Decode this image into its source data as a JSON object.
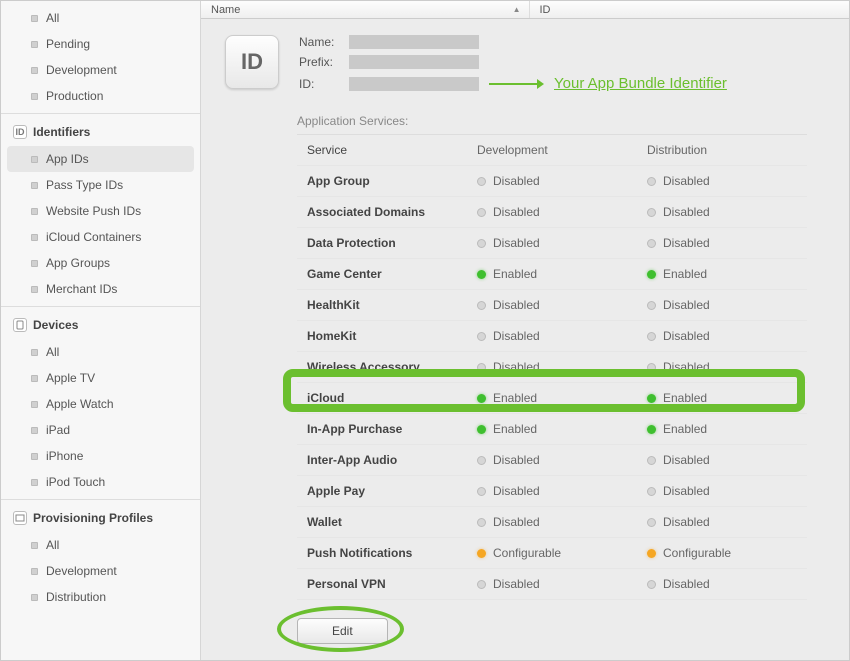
{
  "sidebar": {
    "top_items": [
      {
        "label": "All"
      },
      {
        "label": "Pending"
      },
      {
        "label": "Development"
      },
      {
        "label": "Production"
      }
    ],
    "identifiers": {
      "title": "Identifiers",
      "icon_text": "ID",
      "items": [
        {
          "label": "App IDs",
          "selected": true
        },
        {
          "label": "Pass Type IDs"
        },
        {
          "label": "Website Push IDs"
        },
        {
          "label": "iCloud Containers"
        },
        {
          "label": "App Groups"
        },
        {
          "label": "Merchant IDs"
        }
      ]
    },
    "devices": {
      "title": "Devices",
      "items": [
        {
          "label": "All"
        },
        {
          "label": "Apple TV"
        },
        {
          "label": "Apple Watch"
        },
        {
          "label": "iPad"
        },
        {
          "label": "iPhone"
        },
        {
          "label": "iPod Touch"
        }
      ]
    },
    "provisioning": {
      "title": "Provisioning Profiles",
      "items": [
        {
          "label": "All"
        },
        {
          "label": "Development"
        },
        {
          "label": "Distribution"
        }
      ]
    }
  },
  "table_header": {
    "name": "Name",
    "id": "ID"
  },
  "detail": {
    "icon_text": "ID",
    "name_label": "Name:",
    "prefix_label": "Prefix:",
    "id_label": "ID:",
    "annotation": "Your App Bundle Identifier",
    "services_header": "Application Services:",
    "columns": {
      "service": "Service",
      "development": "Development",
      "distribution": "Distribution"
    },
    "status": {
      "enabled": "Enabled",
      "disabled": "Disabled",
      "configurable": "Configurable"
    },
    "services": [
      {
        "name": "App Group",
        "dev": "disabled",
        "dist": "disabled"
      },
      {
        "name": "Associated Domains",
        "dev": "disabled",
        "dist": "disabled"
      },
      {
        "name": "Data Protection",
        "dev": "disabled",
        "dist": "disabled"
      },
      {
        "name": "Game Center",
        "dev": "enabled",
        "dist": "enabled"
      },
      {
        "name": "HealthKit",
        "dev": "disabled",
        "dist": "disabled"
      },
      {
        "name": "HomeKit",
        "dev": "disabled",
        "dist": "disabled"
      },
      {
        "name": "Wireless Accessory",
        "dev": "disabled",
        "dist": "disabled"
      },
      {
        "name": "iCloud",
        "dev": "enabled",
        "dist": "enabled",
        "highlight": true
      },
      {
        "name": "In-App Purchase",
        "dev": "enabled",
        "dist": "enabled"
      },
      {
        "name": "Inter-App Audio",
        "dev": "disabled",
        "dist": "disabled"
      },
      {
        "name": "Apple Pay",
        "dev": "disabled",
        "dist": "disabled"
      },
      {
        "name": "Wallet",
        "dev": "disabled",
        "dist": "disabled"
      },
      {
        "name": "Push Notifications",
        "dev": "configurable",
        "dist": "configurable"
      },
      {
        "name": "Personal VPN",
        "dev": "disabled",
        "dist": "disabled"
      }
    ],
    "edit_label": "Edit"
  }
}
